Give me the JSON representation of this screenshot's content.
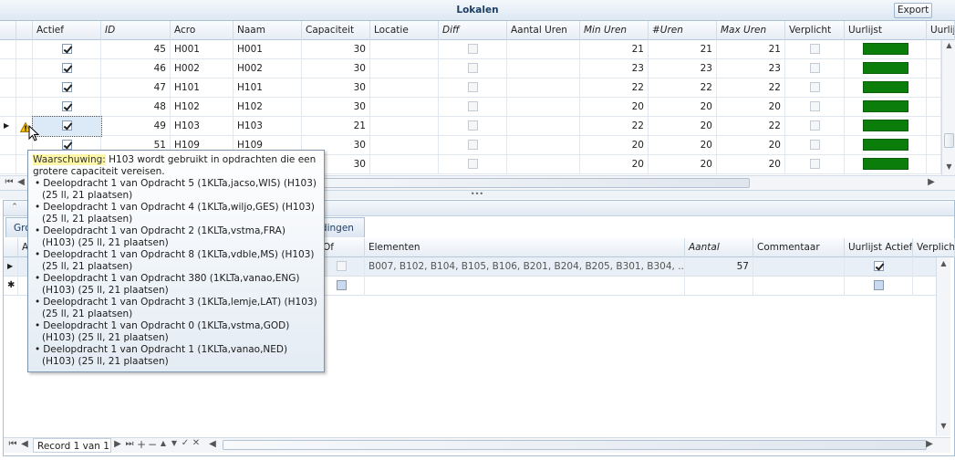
{
  "window": {
    "title": "Lokalen",
    "export_label": "Export"
  },
  "grid": {
    "columns": [
      "",
      "",
      "Actief",
      "ID",
      "Acro",
      "Naam",
      "Capaciteit",
      "Locatie",
      "Diff",
      "Aantal Uren",
      "Min Uren",
      "#Uren",
      "Max Uren",
      "Verplicht",
      "Uurlijst",
      "Uurlijs"
    ],
    "rows": [
      {
        "actief": true,
        "id": "45",
        "acro": "H001",
        "naam": "H001",
        "cap": "30",
        "min": "21",
        "uren": "21",
        "max": "21"
      },
      {
        "actief": true,
        "id": "46",
        "acro": "H002",
        "naam": "H002",
        "cap": "30",
        "min": "23",
        "uren": "23",
        "max": "23"
      },
      {
        "actief": true,
        "id": "47",
        "acro": "H101",
        "naam": "H101",
        "cap": "30",
        "min": "22",
        "uren": "22",
        "max": "22"
      },
      {
        "actief": true,
        "id": "48",
        "acro": "H102",
        "naam": "H102",
        "cap": "30",
        "min": "20",
        "uren": "20",
        "max": "20"
      },
      {
        "actief": true,
        "id": "49",
        "acro": "H103",
        "naam": "H103",
        "cap": "21",
        "min": "22",
        "uren": "20",
        "max": "22"
      },
      {
        "actief": true,
        "id": "51",
        "acro": "H109",
        "naam": "H109",
        "cap": "30",
        "min": "20",
        "uren": "20",
        "max": "20"
      },
      {
        "actief": false,
        "id": "",
        "acro": "",
        "naam": "",
        "cap": "30",
        "min": "20",
        "uren": "20",
        "max": "20"
      }
    ],
    "bar_color": "#0a7d0a"
  },
  "tooltip": {
    "label": "Waarschuwing:",
    "text": " H103 wordt gebruikt in opdrachten die een grotere capaciteit vereisen.",
    "items": [
      "Deelopdracht 1 van Opdracht 5 (1KLTa,jacso,WIS) (H103) (25 ll, 21 plaatsen)",
      "Deelopdracht 1 van Opdracht 4 (1KLTa,wiljo,GES) (H103) (25 ll, 21 plaatsen)",
      "Deelopdracht 1 van Opdracht 2 (1KLTa,vstma,FRA) (H103) (25 ll, 21 plaatsen)",
      "Deelopdracht 1 van Opdracht 8 (1KLTa,vdble,MS) (H103) (25 ll, 21 plaatsen)",
      "Deelopdracht 1 van Opdracht 380 (1KLTa,vanao,ENG) (H103) (25 ll, 21 plaatsen)",
      "Deelopdracht 1 van Opdracht 3 (1KLTa,lemje,LAT) (H103) (25 ll, 21 plaatsen)",
      "Deelopdracht 1 van Opdracht 0 (1KLTa,vstma,GOD) (H103) (25 ll, 21 plaatsen)",
      "Deelopdracht 1 van Opdracht 1 (1KLTa,vanao,NED) (H103) (25 ll, 21 plaatsen)"
    ]
  },
  "lower": {
    "tab_left": "Gro",
    "tab_right": "idingen",
    "columns": {
      "a": "A",
      "of": "Of",
      "elementen": "Elementen",
      "aantal": "Aantal",
      "commentaar": "Commentaar",
      "uurlijst_actief": "Uurlijst Actief",
      "verplicht": "Verplich"
    },
    "row": {
      "elementen": "B007, B102, B104, B105, B106, B201, B204, B205, B301, B304, ...",
      "aantal": "57"
    },
    "record_label": "Record 1 van 1"
  }
}
